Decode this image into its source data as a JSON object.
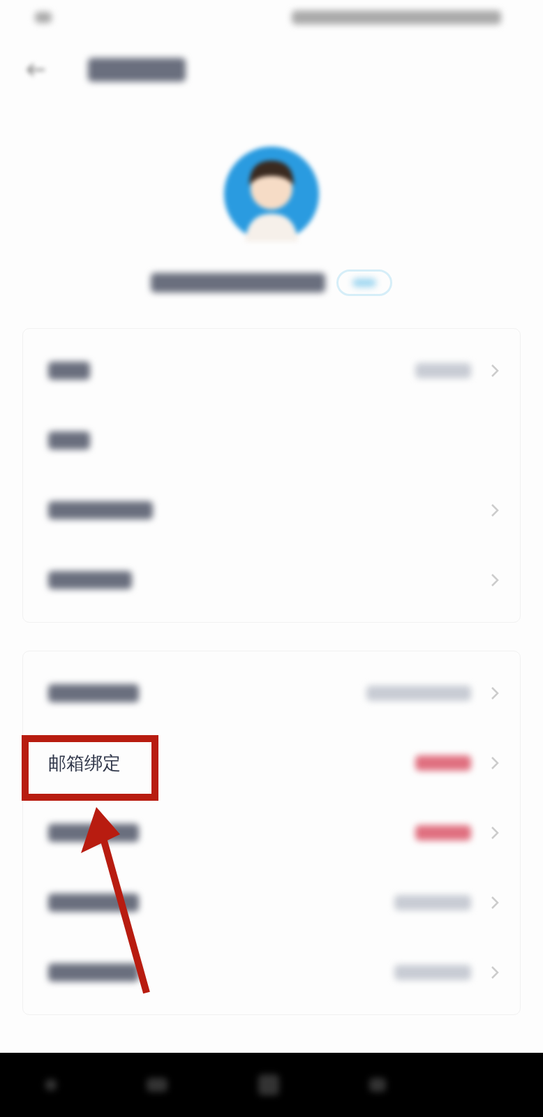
{
  "card_1": {
    "rows": [
      {
        "kind": "link",
        "color": "#c8ccd4"
      },
      {
        "kind": "plain"
      },
      {
        "kind": "link"
      },
      {
        "kind": "link"
      }
    ]
  },
  "card_2": {
    "rows": [
      {
        "kind": "link",
        "color": "#c8ccd4"
      },
      {
        "kind": "link",
        "label": "邮箱绑定",
        "highlighted": true,
        "color": "#e07080"
      },
      {
        "kind": "link",
        "color": "#e07080"
      },
      {
        "kind": "link",
        "color": "#c8ccd4"
      },
      {
        "kind": "link",
        "color": "#c8ccd4"
      }
    ]
  }
}
